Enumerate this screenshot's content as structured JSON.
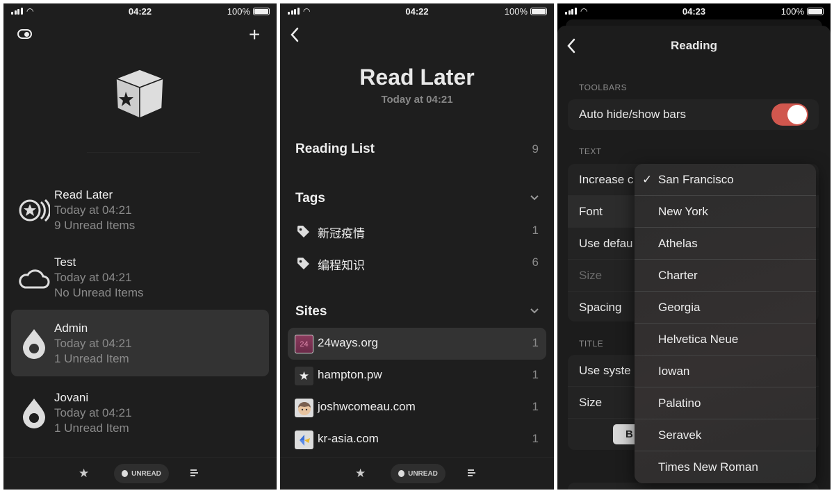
{
  "screen1": {
    "status": {
      "time": "04:22",
      "battery": "100%"
    },
    "icons": {
      "left": "toggle-icon",
      "right": "plus-icon",
      "logo": "cube-star-icon"
    },
    "accounts": [
      {
        "name": "Read Later",
        "updated": "Today at 04:21",
        "unread": "9 Unread Items",
        "icon": "star-circle-icon"
      },
      {
        "name": "Test",
        "updated": "Today at 04:21",
        "unread": "No Unread Items",
        "icon": "cloud-icon"
      },
      {
        "name": "Admin",
        "updated": "Today at 04:21",
        "unread": "1 Unread Item",
        "icon": "drop-icon",
        "selected": true
      },
      {
        "name": "Jovani",
        "updated": "Today at 04:21",
        "unread": "1 Unread Item",
        "icon": "drop-icon"
      }
    ],
    "bottom": {
      "filter_label": "UNREAD"
    }
  },
  "screen2": {
    "status": {
      "time": "04:22",
      "battery": "100%"
    },
    "title": "Read Later",
    "subtitle": "Today at 04:21",
    "reading_list": {
      "label": "Reading List",
      "count": "9"
    },
    "tags": {
      "label": "Tags",
      "items": [
        {
          "label": "新冠疫情",
          "count": "1"
        },
        {
          "label": "编程知识",
          "count": "6"
        }
      ]
    },
    "sites": {
      "label": "Sites",
      "items": [
        {
          "label": "24ways.org",
          "count": "1",
          "favicon": "24",
          "selected": true
        },
        {
          "label": "hampton.pw",
          "count": "1",
          "favicon": "★"
        },
        {
          "label": "joshwcomeau.com",
          "count": "1",
          "favicon": "face"
        },
        {
          "label": "kr-asia.com",
          "count": "1",
          "favicon": "kr"
        }
      ]
    },
    "bottom": {
      "filter_label": "UNREAD"
    }
  },
  "screen3": {
    "status": {
      "time": "04:23",
      "battery": "100%"
    },
    "title": "Reading",
    "toolbars": {
      "caption": "TOOLBARS",
      "auto_hide": "Auto hide/show bars",
      "auto_hide_on": true,
      "toggle_color": "#d0574e"
    },
    "text": {
      "caption": "TEXT",
      "rows": [
        "Increase c",
        "Font",
        "Use defau",
        "Size",
        "Spacing"
      ]
    },
    "title_section": {
      "caption": "TITLE",
      "rows": [
        "Use syste",
        "Size"
      ],
      "button": "B"
    },
    "font_menu": {
      "selected": "San Francisco",
      "options": [
        "San Francisco",
        "New York",
        "Athelas",
        "Charter",
        "Georgia",
        "Helvetica Neue",
        "Iowan",
        "Palatino",
        "Seravek",
        "Times New Roman"
      ]
    }
  }
}
